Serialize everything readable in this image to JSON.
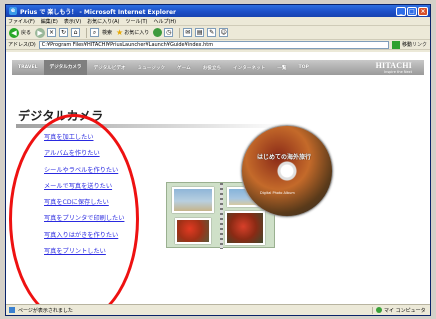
{
  "window": {
    "title": "Prius で 楽しもう！ - Microsoft Internet Explorer",
    "icon_name": "internet-explorer-icon",
    "buttons": [
      "_",
      "□",
      "×"
    ]
  },
  "menubar": [
    "ファイル(F)",
    "編集(E)",
    "表示(V)",
    "お気に入り(A)",
    "ツール(T)",
    "ヘルプ(H)"
  ],
  "toolbar": {
    "back_label": "戻る",
    "search_label": "検索",
    "favorites_label": "お気に入り"
  },
  "address": {
    "label": "アドレス(D)",
    "value": "C:¥Program Files¥HITACHI¥PriusLauncher¥Launch¥Guide¥index.htm",
    "go_label": "移動",
    "links_label": "リンク"
  },
  "site_nav": {
    "items": [
      "TRAVEL",
      "デジタルカメラ",
      "デジタルビデオ",
      "ミュージック",
      "ゲーム",
      "お役立ち",
      "インターネット",
      "一覧",
      "TOP"
    ],
    "active_index": 1,
    "brand": "HITACHI",
    "brand_tagline": "Inspire the Next"
  },
  "section": {
    "title": "デジタルカメラ"
  },
  "links": [
    "写真を加工したい",
    "アルバムを作りたい",
    "シールやラベルを作りたい",
    "メールで写真を送りたい",
    "写真をCDに保存したい",
    "写真をプリンタで印刷したい",
    "写真入りはがきを作りたい",
    "写真をプリントしたい"
  ],
  "cd_art": {
    "title": "はじめての海外旅行",
    "subtitle": "Digital Photo Album"
  },
  "statusbar": {
    "text": "ページが表示されました",
    "zone": "マイ コンピュータ"
  },
  "colors": {
    "link": "#2a2ae0",
    "annotation": "#ee1111",
    "titlebar": "#1c4fc8"
  }
}
